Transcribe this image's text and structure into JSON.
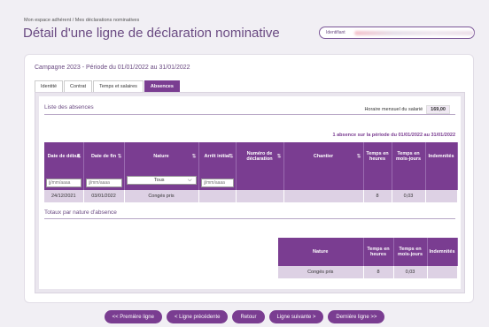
{
  "header": {
    "breadcrumb": "Mon espace adhérent / Mes déclarations nominatives",
    "title": "Détail d'une ligne de déclaration nominative",
    "identifiant_label": "Identifiant"
  },
  "campagne": "Campagne 2023 - Période du 01/01/2022 au 31/01/2022",
  "tabs": [
    {
      "label": "Identité",
      "active": false
    },
    {
      "label": "Contrat",
      "active": false
    },
    {
      "label": "Temps et salaires",
      "active": false
    },
    {
      "label": "Absences",
      "active": true
    }
  ],
  "absences": {
    "section_title": "Liste des absences",
    "horaire_label": "Horaire mensuel du salarié",
    "horaire_value": "169,00",
    "count_text": "1 absence sur la période du 01/01/2022 au 31/01/2022",
    "columns": [
      "Date de début",
      "Date de fin",
      "Nature",
      "Arrêt initial",
      "Numéro de déclaration",
      "Chantier",
      "Temps en heures",
      "Temps en mois-jours",
      "Indemnités"
    ],
    "filters": {
      "date_placeholder": "jj/mm/aaaa",
      "nature_selected": "Tous"
    },
    "rows": [
      [
        "24/12/2021",
        "03/01/2022",
        "Congés pris",
        "",
        "",
        "",
        "8",
        "0,03",
        ""
      ]
    ]
  },
  "totaux": {
    "section_title": "Totaux par nature d'absence",
    "columns": [
      "Nature",
      "Temps en heures",
      "Temps en mois-jours",
      "Indemnités"
    ],
    "rows": [
      [
        "Congés pris",
        "8",
        "0,03",
        ""
      ]
    ]
  },
  "footer": {
    "first": "<< Première ligne",
    "prev": "< Ligne précédente",
    "back": "Retour",
    "next": "Ligne suivante >",
    "last": "Dernière ligne >>"
  },
  "colors": {
    "primary": "#7a3d91",
    "row_bg": "#ddd1e4",
    "title": "#6a4a82"
  }
}
